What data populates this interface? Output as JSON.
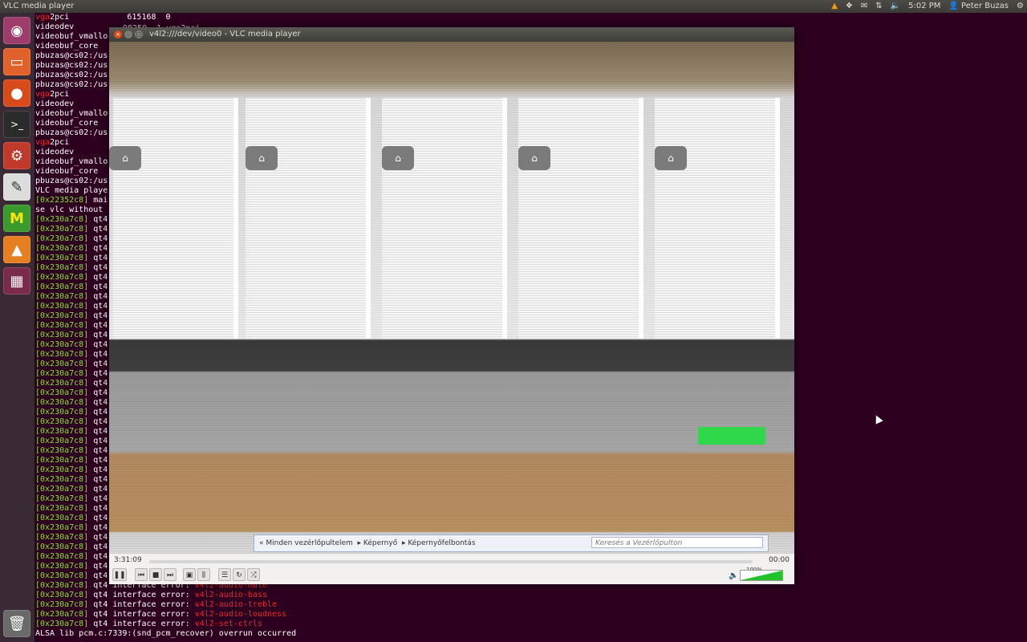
{
  "top_panel": {
    "app_title": "VLC media player",
    "clock": "5:02 PM",
    "user": "Peter Buzas",
    "indicators": [
      "vlc-tray-icon",
      "dropbox-icon",
      "mail-icon",
      "network-icon",
      "volume-icon"
    ]
  },
  "launcher": {
    "items": [
      {
        "name": "dash-home",
        "glyph": "◉"
      },
      {
        "name": "files",
        "glyph": "▭"
      },
      {
        "name": "firefox",
        "glyph": "●"
      },
      {
        "name": "terminal",
        "glyph": ">_"
      },
      {
        "name": "system-settings",
        "glyph": "⚙"
      },
      {
        "name": "text-editor",
        "glyph": "✎"
      },
      {
        "name": "app-m",
        "glyph": "M"
      },
      {
        "name": "vlc",
        "glyph": "▲"
      },
      {
        "name": "workspace-switcher",
        "glyph": "▦"
      },
      {
        "name": "trash",
        "glyph": "🗑"
      }
    ]
  },
  "terminal": {
    "lines": [
      [
        {
          "t": "vga",
          "c": "red"
        },
        {
          "t": "2pci            615168  0",
          "c": "white"
        }
      ],
      [
        {
          "t": "videodev",
          "c": "white"
        }
      ],
      [
        {
          "t": "videobuf_vmallo",
          "c": "white"
        }
      ],
      [
        {
          "t": "videobuf_core",
          "c": "white"
        }
      ],
      [
        {
          "t": "pbuzas@cs02:/us",
          "c": "white"
        }
      ],
      [
        {
          "t": "pbuzas@cs02:/us",
          "c": "white"
        }
      ],
      [
        {
          "t": "pbuzas@cs02:/us",
          "c": "white"
        }
      ],
      [
        {
          "t": "pbuzas@cs02:/us",
          "c": "white"
        }
      ],
      [
        {
          "t": "vga",
          "c": "red"
        },
        {
          "t": "2pci",
          "c": "white"
        }
      ],
      [
        {
          "t": "videodev",
          "c": "white"
        }
      ],
      [
        {
          "t": "videobuf_vmallo",
          "c": "white"
        }
      ],
      [
        {
          "t": "videobuf_core",
          "c": "white"
        }
      ],
      [
        {
          "t": "pbuzas@cs02:/us",
          "c": "white"
        }
      ],
      [
        {
          "t": "vga",
          "c": "red"
        },
        {
          "t": "2pci",
          "c": "white"
        }
      ],
      [
        {
          "t": "videodev",
          "c": "white"
        }
      ],
      [
        {
          "t": "videobuf_vmallo",
          "c": "white"
        }
      ],
      [
        {
          "t": "videobuf_core",
          "c": "white"
        }
      ],
      [
        {
          "t": "pbuzas@cs02:/us",
          "c": "white"
        }
      ],
      [
        {
          "t": "VLC media playe",
          "c": "white"
        }
      ],
      [
        {
          "t": "[0x22352c8]",
          "c": "green"
        },
        {
          "t": " mai",
          "c": "white"
        }
      ],
      [
        {
          "t": "se vlc without",
          "c": "white"
        }
      ],
      [
        {
          "t": "[0x230a7c8]",
          "c": "green"
        },
        {
          "t": " qt4",
          "c": "white"
        }
      ],
      [
        {
          "t": "[0x230a7c8]",
          "c": "green"
        },
        {
          "t": " qt4",
          "c": "white"
        }
      ],
      [
        {
          "t": "[0x230a7c8]",
          "c": "green"
        },
        {
          "t": " qt4",
          "c": "white"
        }
      ],
      [
        {
          "t": "[0x230a7c8]",
          "c": "green"
        },
        {
          "t": " qt4",
          "c": "white"
        }
      ],
      [
        {
          "t": "[0x230a7c8]",
          "c": "green"
        },
        {
          "t": " qt4",
          "c": "white"
        }
      ],
      [
        {
          "t": "[0x230a7c8]",
          "c": "green"
        },
        {
          "t": " qt4",
          "c": "white"
        }
      ],
      [
        {
          "t": "[0x230a7c8]",
          "c": "green"
        },
        {
          "t": " qt4",
          "c": "white"
        }
      ],
      [
        {
          "t": "[0x230a7c8]",
          "c": "green"
        },
        {
          "t": " qt4",
          "c": "white"
        }
      ],
      [
        {
          "t": "[0x230a7c8]",
          "c": "green"
        },
        {
          "t": " qt4",
          "c": "white"
        }
      ],
      [
        {
          "t": "[0x230a7c8]",
          "c": "green"
        },
        {
          "t": " qt4",
          "c": "white"
        }
      ],
      [
        {
          "t": "[0x230a7c8]",
          "c": "green"
        },
        {
          "t": " qt4",
          "c": "white"
        }
      ],
      [
        {
          "t": "[0x230a7c8]",
          "c": "green"
        },
        {
          "t": " qt4",
          "c": "white"
        }
      ],
      [
        {
          "t": "[0x230a7c8]",
          "c": "green"
        },
        {
          "t": " qt4",
          "c": "white"
        }
      ],
      [
        {
          "t": "[0x230a7c8]",
          "c": "green"
        },
        {
          "t": " qt4",
          "c": "white"
        }
      ],
      [
        {
          "t": "[0x230a7c8]",
          "c": "green"
        },
        {
          "t": " qt4",
          "c": "white"
        }
      ],
      [
        {
          "t": "[0x230a7c8]",
          "c": "green"
        },
        {
          "t": " qt4",
          "c": "white"
        }
      ],
      [
        {
          "t": "[0x230a7c8]",
          "c": "green"
        },
        {
          "t": " qt4",
          "c": "white"
        }
      ],
      [
        {
          "t": "[0x230a7c8]",
          "c": "green"
        },
        {
          "t": " qt4",
          "c": "white"
        }
      ],
      [
        {
          "t": "[0x230a7c8]",
          "c": "green"
        },
        {
          "t": " qt4",
          "c": "white"
        }
      ],
      [
        {
          "t": "[0x230a7c8]",
          "c": "green"
        },
        {
          "t": " qt4",
          "c": "white"
        }
      ],
      [
        {
          "t": "[0x230a7c8]",
          "c": "green"
        },
        {
          "t": " qt4",
          "c": "white"
        }
      ],
      [
        {
          "t": "[0x230a7c8]",
          "c": "green"
        },
        {
          "t": " qt4",
          "c": "white"
        }
      ],
      [
        {
          "t": "[0x230a7c8]",
          "c": "green"
        },
        {
          "t": " qt4",
          "c": "white"
        }
      ],
      [
        {
          "t": "[0x230a7c8]",
          "c": "green"
        },
        {
          "t": " qt4",
          "c": "white"
        }
      ],
      [
        {
          "t": "[0x230a7c8]",
          "c": "green"
        },
        {
          "t": " qt4",
          "c": "white"
        }
      ],
      [
        {
          "t": "[0x230a7c8]",
          "c": "green"
        },
        {
          "t": " qt4",
          "c": "white"
        }
      ],
      [
        {
          "t": "[0x230a7c8]",
          "c": "green"
        },
        {
          "t": " qt4",
          "c": "white"
        }
      ],
      [
        {
          "t": "[0x230a7c8]",
          "c": "green"
        },
        {
          "t": " qt4",
          "c": "white"
        }
      ],
      [
        {
          "t": "[0x230a7c8]",
          "c": "green"
        },
        {
          "t": " qt4",
          "c": "white"
        }
      ],
      [
        {
          "t": "[0x230a7c8]",
          "c": "green"
        },
        {
          "t": " qt4",
          "c": "white"
        }
      ],
      [
        {
          "t": "[0x230a7c8]",
          "c": "green"
        },
        {
          "t": " qt4",
          "c": "white"
        }
      ],
      [
        {
          "t": "[0x230a7c8]",
          "c": "green"
        },
        {
          "t": " qt4",
          "c": "white"
        }
      ],
      [
        {
          "t": "[0x230a7c8]",
          "c": "green"
        },
        {
          "t": " qt4",
          "c": "white"
        }
      ],
      [
        {
          "t": "[0x230a7c8]",
          "c": "green"
        },
        {
          "t": " qt4",
          "c": "white"
        }
      ],
      [
        {
          "t": "[0x230a7c8]",
          "c": "green"
        },
        {
          "t": " qt4",
          "c": "white"
        }
      ],
      [
        {
          "t": "[0x230a7c8]",
          "c": "green"
        },
        {
          "t": " qt4",
          "c": "white"
        }
      ],
      [
        {
          "t": "[0x230a7c8]",
          "c": "green"
        },
        {
          "t": " qt4",
          "c": "white"
        }
      ],
      [
        {
          "t": "[0x230a7c8]",
          "c": "green"
        },
        {
          "t": " qt4",
          "c": "white"
        }
      ],
      [
        {
          "t": "[0x230a7c8]",
          "c": "green"
        },
        {
          "t": " qt4 interface error: ",
          "c": "white"
        },
        {
          "t": "v4l2-audio-mute",
          "c": "red"
        }
      ],
      [
        {
          "t": "[0x230a7c8]",
          "c": "green"
        },
        {
          "t": " qt4 interface error: ",
          "c": "white"
        },
        {
          "t": "v4l2-audio-bass",
          "c": "red"
        }
      ],
      [
        {
          "t": "[0x230a7c8]",
          "c": "green"
        },
        {
          "t": " qt4 interface error: ",
          "c": "white"
        },
        {
          "t": "v4l2-audio-treble",
          "c": "red"
        }
      ],
      [
        {
          "t": "[0x230a7c8]",
          "c": "green"
        },
        {
          "t": " qt4 interface error: ",
          "c": "white"
        },
        {
          "t": "v4l2-audio-loudness",
          "c": "red"
        }
      ],
      [
        {
          "t": "[0x230a7c8]",
          "c": "green"
        },
        {
          "t": " qt4 interface error: ",
          "c": "white"
        },
        {
          "t": "v4l2-set-ctrls",
          "c": "red"
        }
      ],
      [
        {
          "t": "ALSA lib pcm.c:7339:(snd_pcm_recover) overrun occurred",
          "c": "white"
        }
      ]
    ],
    "partial_line": "98250  1 vga2pci"
  },
  "vlc": {
    "window_title": "v4l2:///dev/video0 - VLC media player",
    "time_elapsed": "3:31:09",
    "time_total": "00:00",
    "volume_label": "100%",
    "volume_fraction": 1.0,
    "video_content": {
      "breadcrumbs": [
        "Minden vezérlőpultelem",
        "Képernyő",
        "Képernyőfelbontás"
      ],
      "search_placeholder": "Keresés a Vezérlőpulton"
    }
  }
}
